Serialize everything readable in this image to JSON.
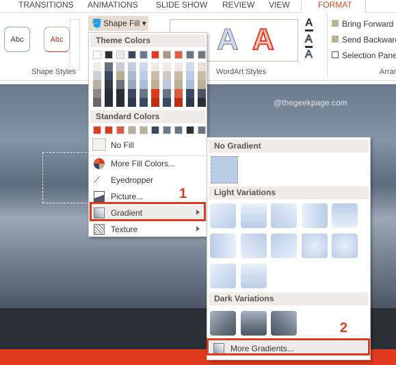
{
  "tabs": [
    {
      "label": "TRANSITIONS"
    },
    {
      "label": "ANIMATIONS"
    },
    {
      "label": "SLIDE SHOW"
    },
    {
      "label": "REVIEW"
    },
    {
      "label": "VIEW"
    },
    {
      "label": "FORMAT",
      "active": true
    }
  ],
  "ribbon": {
    "shape_styles": {
      "samples": [
        "Abc",
        "Abc"
      ],
      "label": "Shape Styles"
    },
    "shape_fill": {
      "label": "Shape Fill",
      "icon": "paint-bucket-icon"
    },
    "wordart": {
      "samples": [
        "A",
        "A"
      ],
      "label": "WordArt Styles"
    },
    "arrange": {
      "bring_forward": "Bring Forward",
      "send_backward": "Send Backward",
      "selection_pane": "Selection Pane",
      "label": "Arran"
    }
  },
  "watermark": "@thegeekpage.com",
  "fill_menu": {
    "theme_header": "Theme Colors",
    "theme_colors": [
      "#ffffff",
      "#2b2f35",
      "#e8e8ee",
      "#3a4a5e",
      "#6a7a8e",
      "#e03a1e",
      "#a89a80",
      "#e05a40",
      "#6a7582",
      "#707a82"
    ],
    "theme_shades": [
      [
        "#f0ece8",
        "#c8d0d8",
        "#b8b0a0",
        "#8a8a8a",
        "#6a6a6a"
      ],
      [
        "#6a7280",
        "#3a4a5e",
        "#343a44",
        "#2b2f35",
        "#2b2f35"
      ],
      [
        "#c8ccd4",
        "#b8ac94",
        "#6a7282",
        "#2b2f35",
        "#2b2f35"
      ],
      [
        "#c0cee0",
        "#a8b8cc",
        "#9aa8b8",
        "#3a4a5e",
        "#2e3a4a"
      ],
      [
        "#cdd8e8",
        "#b8cce6",
        "#a8bcd8",
        "#6a7582",
        "#3a4a5e"
      ],
      [
        "#efebe8",
        "#c8bca4",
        "#bcb094",
        "#e03a1e",
        "#c02c14"
      ],
      [
        "#efebe8",
        "#d0c8bc",
        "#b8c8e0",
        "#6a7582",
        "#3a4a5e"
      ],
      [
        "#efebe8",
        "#c8bca4",
        "#bcb094",
        "#e05a40",
        "#c02c14"
      ],
      [
        "#d0dcec",
        "#b8cce6",
        "#a8bcd8",
        "#3a4a5e",
        "#2e3a4a"
      ],
      [
        "#e8e0d4",
        "#c8bca4",
        "#bcb094",
        "#4a5464",
        "#2b2f35"
      ]
    ],
    "standard_header": "Standard Colors",
    "standard_colors": [
      "#e03a1e",
      "#e03a1e",
      "#e05a40",
      "#bcb094",
      "#bcb094",
      "#3a4a5e",
      "#6a7a8e",
      "#6a7582",
      "#2b2f35",
      "#6a7582"
    ],
    "items": [
      {
        "label": "No Fill",
        "icon": "no-fill-swatch-icon"
      },
      {
        "label": "More Fill Colors...",
        "icon": "color-wheel-icon"
      },
      {
        "label": "Eyedropper",
        "icon": "eyedropper-icon"
      },
      {
        "label": "Picture...",
        "icon": "picture-icon"
      },
      {
        "label": "Gradient",
        "icon": "gradient-icon"
      },
      {
        "label": "Texture",
        "icon": "texture-icon"
      }
    ]
  },
  "gradient_menu": {
    "no_gradient": "No Gradient",
    "light_header": "Light Variations",
    "dark_header": "Dark Variations",
    "more": "More Gradients...",
    "light_color": "#b8cce6",
    "dark_color": "#6a7582"
  },
  "annotations": {
    "step1": "1",
    "step2": "2"
  }
}
